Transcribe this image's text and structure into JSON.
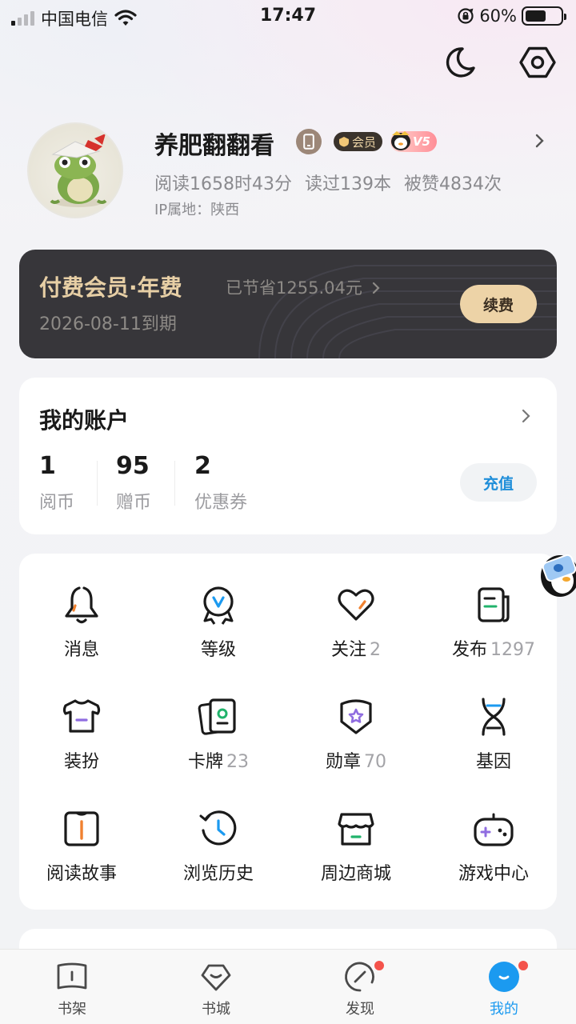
{
  "status_bar": {
    "carrier": "中国电信",
    "time": "17:47",
    "battery_percent": "60%",
    "battery_level": 0.6
  },
  "profile": {
    "username": "养肥翻翻看",
    "vip_badge": "会员",
    "level_badge": "V5",
    "read_time": "阅读1658时43分",
    "books_read": "读过139本",
    "likes": "被赞4834次",
    "ip_location": "IP属地：陕西"
  },
  "vip_card": {
    "title": "付费会员·年费",
    "saved": "已节省1255.04元",
    "expire": "2026-08-11到期",
    "renew_label": "续费"
  },
  "account": {
    "title": "我的账户",
    "items": [
      {
        "value": "1",
        "label": "阅币"
      },
      {
        "value": "95",
        "label": "赠币"
      },
      {
        "value": "2",
        "label": "优惠券"
      }
    ],
    "recharge_label": "充值"
  },
  "grid": {
    "items": [
      {
        "label": "消息",
        "count": ""
      },
      {
        "label": "等级",
        "count": ""
      },
      {
        "label": "关注",
        "count": "2"
      },
      {
        "label": "发布",
        "count": "1297"
      },
      {
        "label": "装扮",
        "count": ""
      },
      {
        "label": "卡牌",
        "count": "23"
      },
      {
        "label": "勋章",
        "count": "70"
      },
      {
        "label": "基因",
        "count": ""
      },
      {
        "label": "阅读故事",
        "count": ""
      },
      {
        "label": "浏览历史",
        "count": ""
      },
      {
        "label": "周边商城",
        "count": ""
      },
      {
        "label": "游戏中心",
        "count": ""
      }
    ]
  },
  "tab_bar": {
    "tabs": [
      {
        "label": "书架"
      },
      {
        "label": "书城"
      },
      {
        "label": "发现"
      },
      {
        "label": "我的"
      }
    ],
    "active_color": "#1b9af0"
  },
  "colors": {
    "vip_gold": "#e7cfa5",
    "vip_card_bg": "#37363a",
    "accent_blue": "#1b9af0",
    "accent_orange": "#f0812f",
    "accent_purple": "#8f6ce0",
    "accent_green": "#21b36b",
    "badge_red": "#f4534b"
  }
}
